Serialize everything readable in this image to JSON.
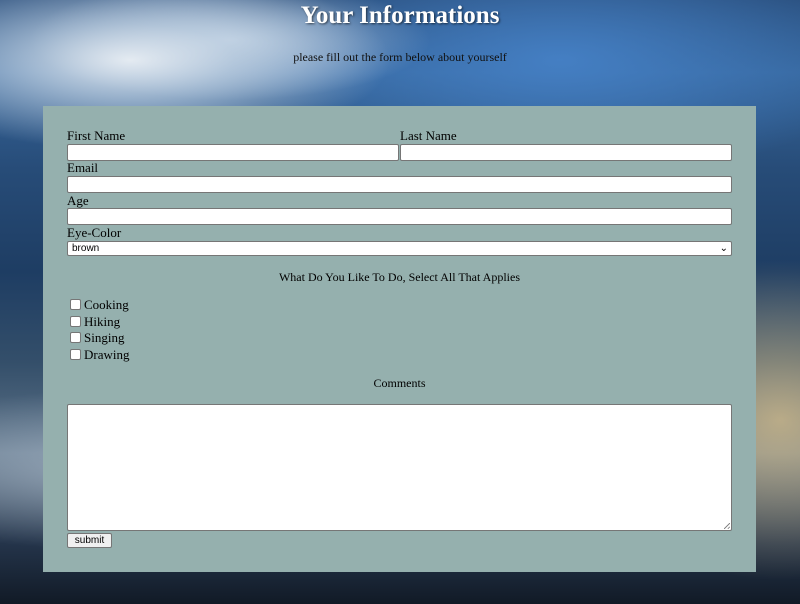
{
  "header": {
    "title": "Your Informations",
    "subtitle": "please fill out the form below about yourself"
  },
  "form": {
    "first_name": {
      "label": "First Name",
      "value": ""
    },
    "last_name": {
      "label": "Last Name",
      "value": ""
    },
    "email": {
      "label": "Email",
      "value": ""
    },
    "age": {
      "label": "Age",
      "value": ""
    },
    "eye_color": {
      "label": "Eye-Color",
      "selected": "brown"
    },
    "activities": {
      "prompt": "What Do You Like To Do, Select All That Applies",
      "options": [
        {
          "label": "Cooking",
          "checked": false
        },
        {
          "label": "Hiking",
          "checked": false
        },
        {
          "label": "Singing",
          "checked": false
        },
        {
          "label": "Drawing",
          "checked": false
        }
      ]
    },
    "comments": {
      "label": "Comments",
      "value": ""
    },
    "submit_label": "submit"
  },
  "colors": {
    "panel_bg": "#95b0ae",
    "title_color": "#ffffff"
  }
}
